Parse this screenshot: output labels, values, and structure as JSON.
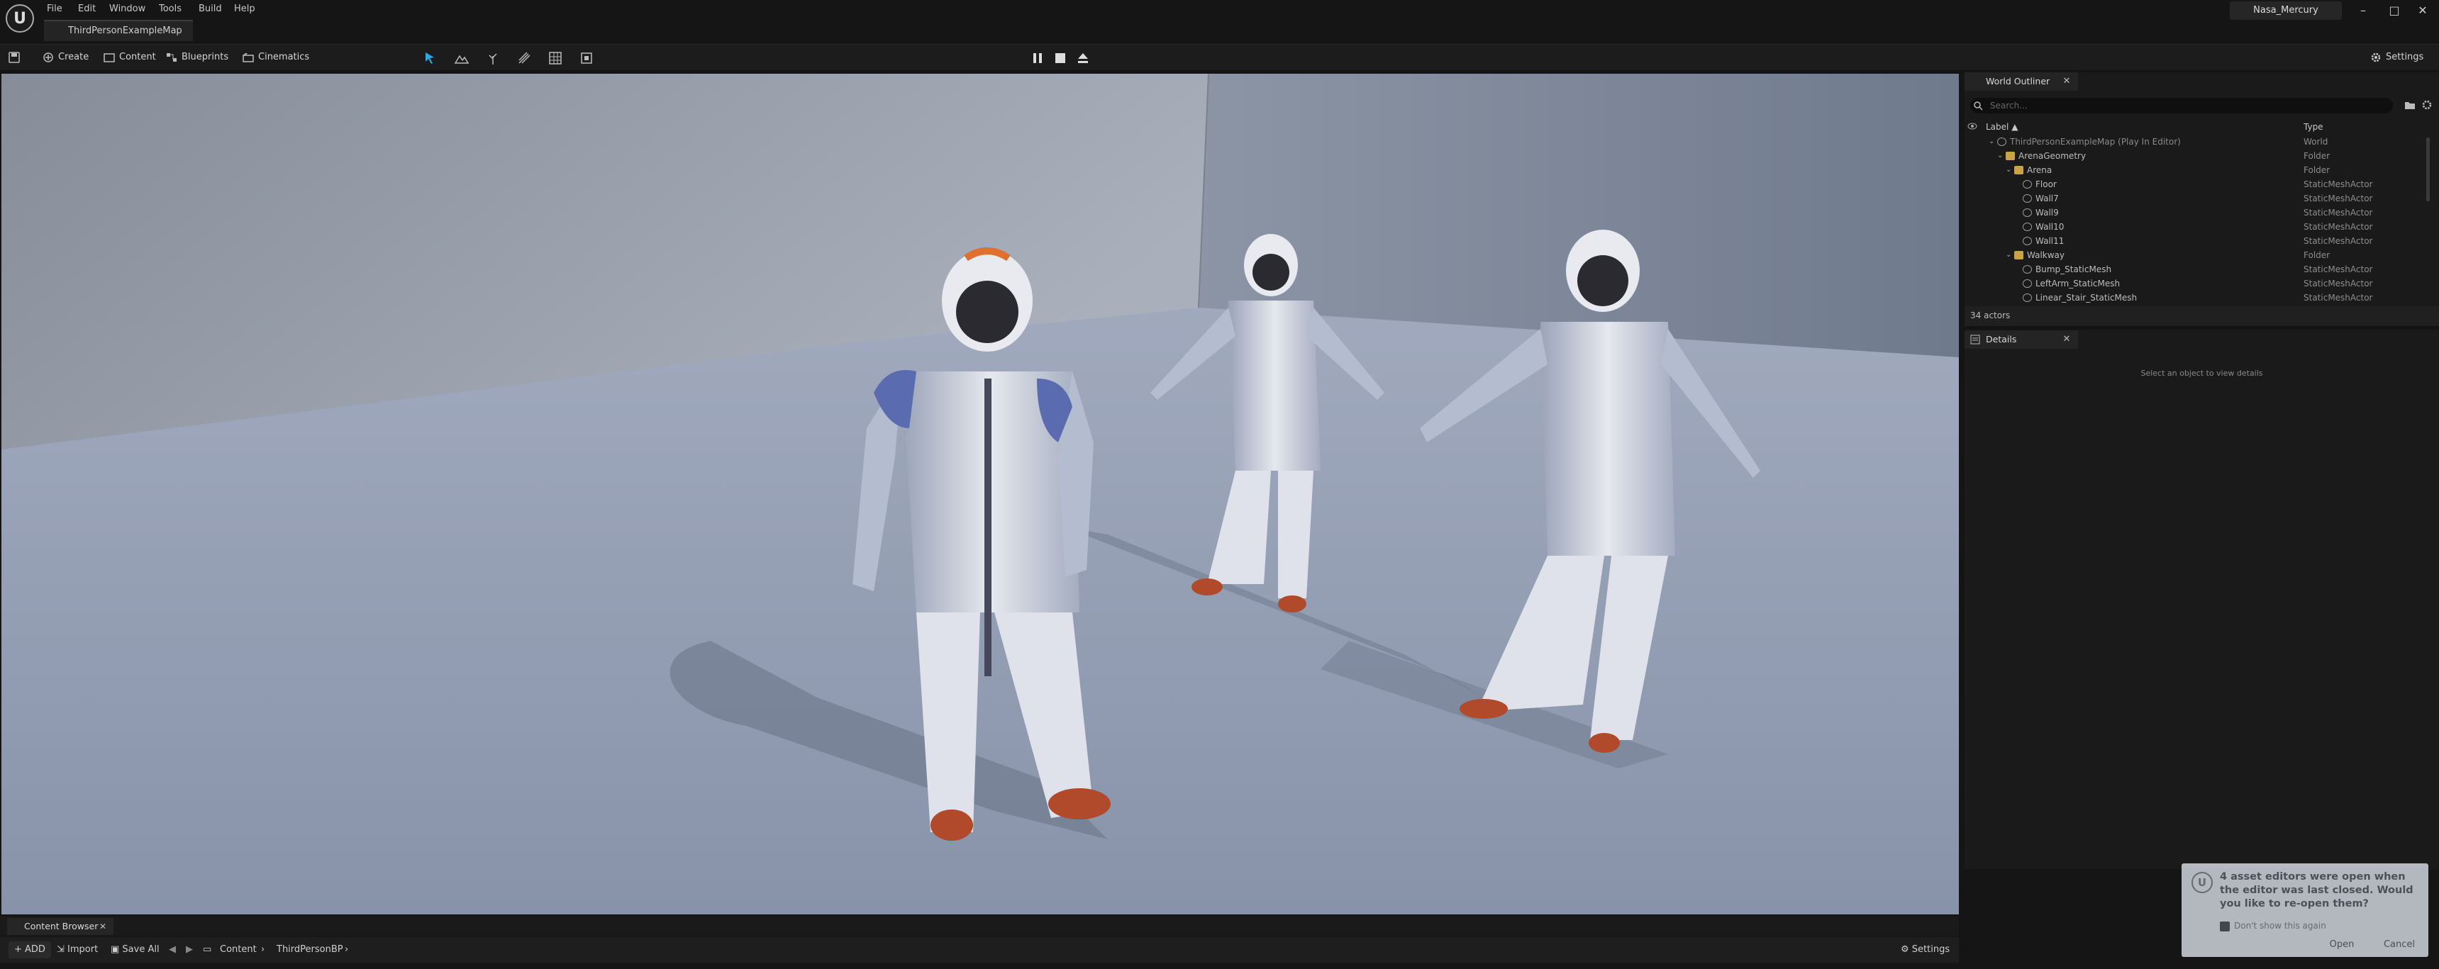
{
  "app": {
    "menu": [
      "File",
      "Edit",
      "Window",
      "Tools",
      "Build",
      "Help"
    ],
    "doc_tab": "ThirdPersonExampleMap",
    "user": "Nasa_Mercury",
    "window_controls": [
      "–",
      "□",
      "✕"
    ]
  },
  "toolbar": {
    "create": "Create",
    "content": "Content",
    "blueprints": "Blueprints",
    "cinematics": "Cinematics",
    "settings": "Settings"
  },
  "outliner": {
    "tab": "World Outliner",
    "search_placeholder": "Search...",
    "col_label": "Label ▲",
    "col_type": "Type",
    "rows": [
      {
        "label": "ThirdPersonExampleMap (Play In Editor)",
        "type": "World"
      },
      {
        "label": "ArenaGeometry",
        "type": "Folder"
      },
      {
        "label": "Arena",
        "type": "Folder"
      },
      {
        "label": "Floor",
        "type": "StaticMeshActor"
      },
      {
        "label": "Wall7",
        "type": "StaticMeshActor"
      },
      {
        "label": "Wall9",
        "type": "StaticMeshActor"
      },
      {
        "label": "Wall10",
        "type": "StaticMeshActor"
      },
      {
        "label": "Wall11",
        "type": "StaticMeshActor"
      },
      {
        "label": "Walkway",
        "type": "Folder"
      },
      {
        "label": "Bump_StaticMesh",
        "type": "StaticMeshActor"
      },
      {
        "label": "LeftArm_StaticMesh",
        "type": "StaticMeshActor"
      },
      {
        "label": "Linear_Stair_StaticMesh",
        "type": "StaticMeshActor"
      }
    ],
    "actor_count": "34 actors"
  },
  "details": {
    "tab": "Details",
    "empty_msg": "Select an object to view details"
  },
  "content_browser": {
    "tab": "Content Browser",
    "add": "ADD",
    "import": "Import",
    "save_all": "Save All",
    "path": [
      "Content",
      "ThirdPersonBP"
    ],
    "settings": "Settings"
  },
  "dialog": {
    "message": "4 asset editors were open when the editor was last closed. Would you like to re-open them?",
    "checkbox": "Don't show this again",
    "open": "Open",
    "cancel": "Cancel"
  },
  "colors": {
    "accent_blue": "#2fa8e6",
    "folder": "#c9a24a",
    "panel_bg": "#1a1a1a"
  }
}
